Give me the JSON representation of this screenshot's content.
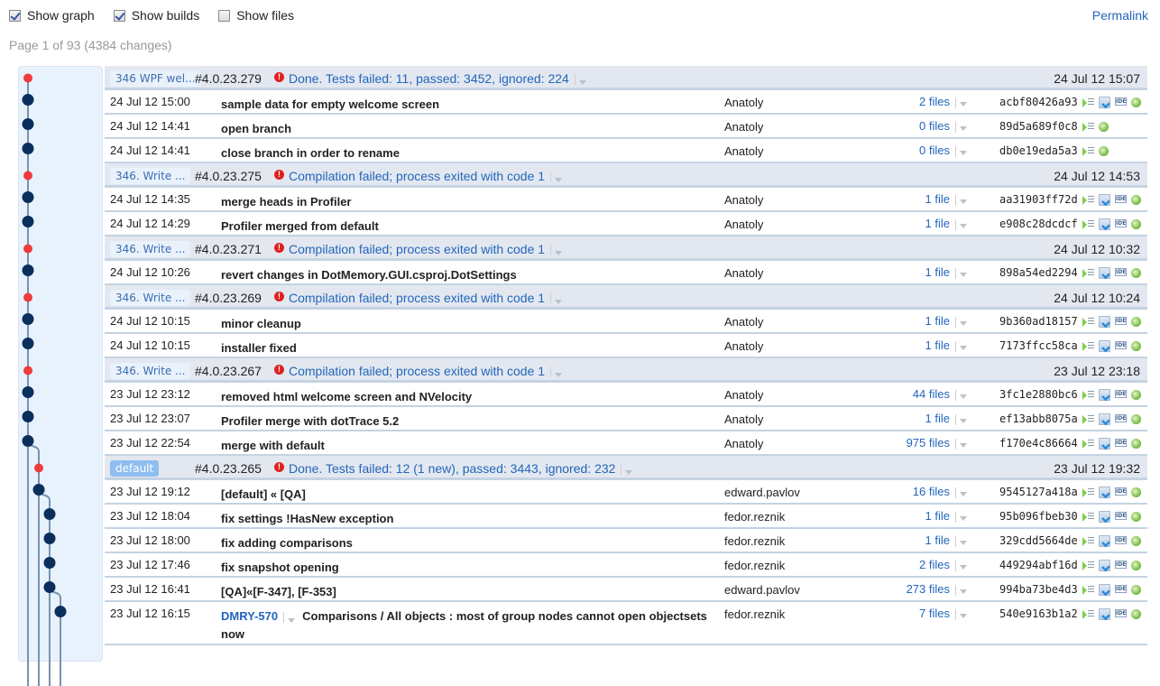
{
  "options": [
    {
      "label": "Show graph",
      "checked": true
    },
    {
      "label": "Show builds",
      "checked": true
    },
    {
      "label": "Show files",
      "checked": false
    }
  ],
  "permalink": "Permalink",
  "page_info": "Page 1 of 93 (4384 changes)",
  "colors": {
    "link": "#2266bb",
    "error": "#e0201f",
    "node": "#0a2f5c",
    "node_failed": "#f03c3c",
    "build_bg": "#e3e8f0"
  },
  "icons": [
    "change-log-icon",
    "download-icon",
    "open-in-ide-icon",
    "web-view-icon"
  ],
  "rows": [
    {
      "type": "build",
      "branch": "346 WPF wel...",
      "number": "#4.0.23.279",
      "status": "Done. Tests failed: 11, passed: 3452, ignored: 224",
      "date": "24 Jul 12 15:07"
    },
    {
      "type": "change",
      "date": "24 Jul 12 15:00",
      "message": "sample data for empty welcome screen",
      "author": "Anatoly",
      "files": "2 files",
      "hash": "acbf80426a93",
      "icons": 4
    },
    {
      "type": "change",
      "date": "24 Jul 12 14:41",
      "message": "open branch",
      "author": "Anatoly",
      "files": "0 files",
      "hash": "89d5a689f0c8",
      "icons": 2
    },
    {
      "type": "change",
      "date": "24 Jul 12 14:41",
      "message": "close branch in order to rename",
      "author": "Anatoly",
      "files": "0 files",
      "hash": "db0e19eda5a3",
      "icons": 2
    },
    {
      "type": "build",
      "branch": "346. Write ...",
      "number": "#4.0.23.275",
      "status": "Compilation failed; process exited with code 1",
      "date": "24 Jul 12 14:53"
    },
    {
      "type": "change",
      "date": "24 Jul 12 14:35",
      "message": "merge heads in Profiler",
      "author": "Anatoly",
      "files": "1 file",
      "hash": "aa31903ff72d",
      "icons": 4
    },
    {
      "type": "change",
      "date": "24 Jul 12 14:29",
      "message": "Profiler merged from default",
      "author": "Anatoly",
      "files": "1 file",
      "hash": "e908c28dcdcf",
      "icons": 4
    },
    {
      "type": "build",
      "branch": "346. Write ...",
      "number": "#4.0.23.271",
      "status": "Compilation failed; process exited with code 1",
      "date": "24 Jul 12 10:32"
    },
    {
      "type": "change",
      "date": "24 Jul 12 10:26",
      "message": "revert changes in DotMemory.GUI.csproj.DotSettings",
      "author": "Anatoly",
      "files": "1 file",
      "hash": "898a54ed2294",
      "icons": 4
    },
    {
      "type": "build",
      "branch": "346. Write ...",
      "number": "#4.0.23.269",
      "status": "Compilation failed; process exited with code 1",
      "date": "24 Jul 12 10:24"
    },
    {
      "type": "change",
      "date": "24 Jul 12 10:15",
      "message": "minor cleanup",
      "author": "Anatoly",
      "files": "1 file",
      "hash": "9b360ad18157",
      "icons": 4
    },
    {
      "type": "change",
      "date": "24 Jul 12 10:15",
      "message": "installer fixed",
      "author": "Anatoly",
      "files": "1 file",
      "hash": "7173ffcc58ca",
      "icons": 4
    },
    {
      "type": "build",
      "branch": "346. Write ...",
      "number": "#4.0.23.267",
      "status": "Compilation failed; process exited with code 1",
      "date": "23 Jul 12 23:18"
    },
    {
      "type": "change",
      "date": "23 Jul 12 23:12",
      "message": "removed html welcome screen and NVelocity",
      "author": "Anatoly",
      "files": "44 files",
      "hash": "3fc1e2880bc6",
      "icons": 4
    },
    {
      "type": "change",
      "date": "23 Jul 12 23:07",
      "message": "Profiler merge with dotTrace 5.2",
      "author": "Anatoly",
      "files": "1 file",
      "hash": "ef13abb8075a",
      "icons": 4
    },
    {
      "type": "change",
      "date": "23 Jul 12 22:54",
      "message": "merge with default",
      "author": "Anatoly",
      "files": "975 files",
      "hash": "f170e4c86664",
      "icons": 4
    },
    {
      "type": "build",
      "branch": "default",
      "default": true,
      "number": "#4.0.23.265",
      "status": "Done. Tests failed: 12 (1 new), passed: 3443, ignored: 232",
      "date": "23 Jul 12 19:32"
    },
    {
      "type": "change",
      "date": "23 Jul 12 19:12",
      "message": "[default] « [QA]",
      "author": "edward.pavlov",
      "files": "16 files",
      "hash": "9545127a418a",
      "icons": 4
    },
    {
      "type": "change",
      "date": "23 Jul 12 18:04",
      "message": "fix settings !HasNew exception",
      "author": "fedor.reznik",
      "files": "1 file",
      "hash": "95b096fbeb30",
      "icons": 4
    },
    {
      "type": "change",
      "date": "23 Jul 12 18:00",
      "message": "fix adding comparisons",
      "author": "fedor.reznik",
      "files": "1 file",
      "hash": "329cdd5664de",
      "icons": 4
    },
    {
      "type": "change",
      "date": "23 Jul 12 17:46",
      "message": "fix snapshot opening",
      "author": "fedor.reznik",
      "files": "2 files",
      "hash": "449294abf16d",
      "icons": 4
    },
    {
      "type": "change",
      "date": "23 Jul 12 16:41",
      "message": "[QA]«[F-347], [F-353]",
      "author": "edward.pavlov",
      "files": "273 files",
      "hash": "994ba73be4d3",
      "icons": 4
    },
    {
      "type": "change",
      "date": "23 Jul 12 16:15",
      "issue": "DMRY-570",
      "message": "Comparisons / All objects : most of group nodes cannot open objectsets now",
      "author": "fedor.reznik",
      "files": "7 files",
      "hash": "540e9163b1a2",
      "icons": 4,
      "tall": true
    }
  ]
}
